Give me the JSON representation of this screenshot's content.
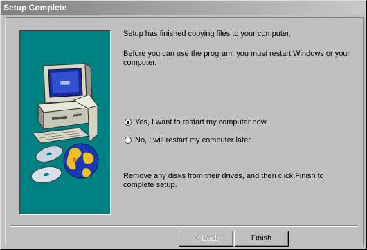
{
  "window": {
    "title": "Setup Complete"
  },
  "messages": {
    "finished": "Setup has finished copying files to your computer.",
    "restart_notice": "Before you can use the program, you must restart Windows or your computer.",
    "remove_disks": "Remove any disks from their drives, and then click Finish to complete setup."
  },
  "restart_options": [
    {
      "label": "Yes, I want to restart my computer now.",
      "selected": true
    },
    {
      "label": "No, I will restart my computer later.",
      "selected": false
    }
  ],
  "buttons": {
    "back_label": "< Back",
    "finish_label": "Finish"
  },
  "colors": {
    "panel_teal": "#008080",
    "face": "#c0c0c0",
    "title_gray": "#808080"
  },
  "icons": {
    "artwork": "computer-cd-globe-illustration"
  }
}
